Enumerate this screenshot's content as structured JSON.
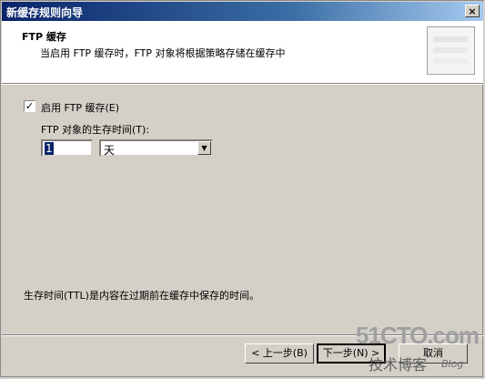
{
  "window": {
    "title": "新缓存规则向导",
    "close_glyph": "×"
  },
  "header": {
    "title": "FTP 缓存",
    "subtitle": "当启用 FTP 缓存时，FTP 对象将根据策略存储在缓存中"
  },
  "form": {
    "enable_checkbox": {
      "checked": true,
      "glyph": "✓",
      "label": "启用 FTP 缓存(E)"
    },
    "ttl_label": "FTP 对象的生存时间(T):",
    "ttl_value": "1",
    "unit_selected": "天",
    "dropdown_glyph": "▼"
  },
  "info_text": "生存时间(TTL)是内容在过期前在缓存中保存的时间。",
  "buttons": {
    "back": "< 上一步(B)",
    "next": "下一步(N) >",
    "cancel": "取消"
  },
  "watermark": {
    "main": "51CTO.com",
    "sub": "技术博客",
    "blog": "Blog"
  }
}
